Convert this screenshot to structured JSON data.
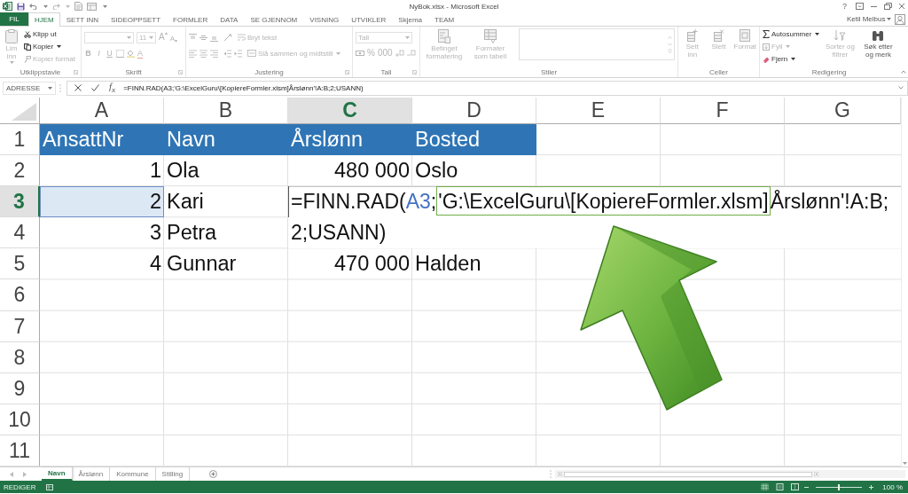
{
  "title_bar": {
    "title": "NyBok.xlsx - Microsoft Excel",
    "help": "?",
    "user": "Ketil Melbus"
  },
  "tabs": [
    {
      "label": "FIL",
      "kind": "backstage",
      "selected": false
    },
    {
      "label": "HJEM",
      "kind": "ribbon",
      "selected": true
    },
    {
      "label": "SETT INN",
      "kind": "ribbon",
      "selected": false
    },
    {
      "label": "SIDEOPPSETT",
      "kind": "ribbon",
      "selected": false
    },
    {
      "label": "FORMLER",
      "kind": "ribbon",
      "selected": false
    },
    {
      "label": "DATA",
      "kind": "ribbon",
      "selected": false
    },
    {
      "label": "SE GJENNOM",
      "kind": "ribbon",
      "selected": false
    },
    {
      "label": "VISNING",
      "kind": "ribbon",
      "selected": false
    },
    {
      "label": "UTVIKLER",
      "kind": "ribbon",
      "selected": false
    },
    {
      "label": "Skjema",
      "kind": "ribbon",
      "selected": false
    },
    {
      "label": "TEAM",
      "kind": "ribbon",
      "selected": false
    }
  ],
  "ribbon": {
    "clipboard": {
      "label": "Utklippstavle",
      "paste": {
        "label": "Lim inn",
        "disabled": true
      },
      "cut": {
        "label": "Klipp ut",
        "disabled": false
      },
      "copy": {
        "label": "Kopier",
        "disabled": false
      },
      "format_painter": {
        "label": "Kopier format",
        "disabled": true
      }
    },
    "font": {
      "label": "Skrift",
      "disabled": true,
      "size": "11",
      "grow": "A",
      "shrink": "A",
      "format_buttons": [
        {
          "label": "B",
          "kind": "bold"
        },
        {
          "label": "I",
          "kind": "italic"
        },
        {
          "label": "U",
          "kind": "underline"
        }
      ],
      "font_color": "A"
    },
    "alignment": {
      "label": "Justering",
      "disabled": true,
      "wrap_text": "Bryt tekst",
      "merge_center": "Slå sammen og midtstill"
    },
    "number": {
      "label": "Tall",
      "disabled": true,
      "format": "Tall",
      "percent": "%",
      "thousands": "000"
    },
    "styles": {
      "label": "Stiler",
      "disabled": true,
      "conditional_formatting": "Betinget formatering",
      "format_as_table": "Formater som tabell"
    },
    "cells": {
      "label": "Celler",
      "disabled": true,
      "insert": "Sett inn",
      "delete": "Slett",
      "format": "Format"
    },
    "editing": {
      "label": "Redigering",
      "autosum": {
        "label": "Autosummer",
        "disabled": false
      },
      "fill": {
        "label": "Fyll",
        "disabled": true
      },
      "clear": {
        "label": "Fjern",
        "disabled": false
      },
      "sort_filter": {
        "label": "Sorter og filtrer",
        "disabled": true
      },
      "find_select": {
        "label": "Søk etter og merk",
        "disabled": false
      }
    }
  },
  "formula_bar": {
    "name_box": "ADRESSE",
    "function_label": "f$_{x}$",
    "formula": "=FINN.RAD(A3;'G:\\ExcelGuru\\[KopiereFormler.xlsm]Årslønn'!A:B;2;USANN)"
  },
  "sheet": {
    "columns": [
      {
        "label": "A",
        "selected": false
      },
      {
        "label": "B",
        "selected": false
      },
      {
        "label": "C",
        "selected": true
      },
      {
        "label": "D",
        "selected": false
      },
      {
        "label": "E",
        "selected": false
      },
      {
        "label": "F",
        "selected": false
      },
      {
        "label": "G",
        "selected": false
      }
    ],
    "rows": [
      {
        "number": "1",
        "selected": false,
        "cells": [
          {
            "value": "AnsattNr",
            "kind": "heading",
            "referenced": false
          },
          {
            "value": "Navn",
            "kind": "heading",
            "referenced": false
          },
          {
            "value": "Årslønn",
            "kind": "heading",
            "referenced": false
          },
          {
            "value": "Bosted",
            "kind": "heading",
            "referenced": false
          }
        ]
      },
      {
        "number": "2",
        "selected": false,
        "cells": [
          {
            "value": "1",
            "kind": "number",
            "referenced": false
          },
          {
            "value": "Ola",
            "kind": "text",
            "referenced": false
          },
          {
            "value": "480 000",
            "kind": "number",
            "referenced": false
          },
          {
            "value": "Oslo",
            "kind": "text",
            "referenced": false
          }
        ]
      },
      {
        "number": "3",
        "selected": true,
        "cells": [
          {
            "value": "2",
            "kind": "number",
            "referenced": true
          },
          {
            "value": "Kari",
            "kind": "text",
            "referenced": false
          }
        ]
      },
      {
        "number": "4",
        "selected": false,
        "cells": [
          {
            "value": "3",
            "kind": "number",
            "referenced": false
          },
          {
            "value": "Petra",
            "kind": "text",
            "referenced": false
          }
        ]
      },
      {
        "number": "5",
        "selected": false,
        "cells": [
          {
            "value": "4",
            "kind": "number",
            "referenced": false
          },
          {
            "value": "Gunnar",
            "kind": "text",
            "referenced": false
          },
          {
            "value": "470 000",
            "kind": "number",
            "referenced": false
          },
          {
            "value": "Halden",
            "kind": "text",
            "referenced": false
          }
        ]
      },
      {
        "number": "6",
        "selected": false
      },
      {
        "number": "7",
        "selected": false
      },
      {
        "number": "8",
        "selected": false
      },
      {
        "number": "9",
        "selected": false
      },
      {
        "number": "10",
        "selected": false
      },
      {
        "number": "11",
        "selected": false
      }
    ],
    "cell_editor": {
      "lines": [
        [
          {
            "text": "=FINN.RAD(",
            "kind": "plain"
          },
          {
            "text": "A3",
            "kind": "reference"
          },
          {
            "text": ";",
            "kind": "plain"
          },
          {
            "text": "'G:\\ExcelGuru\\[KopiereFormler.xlsm]",
            "kind": "framed"
          },
          {
            "text": "Årslønn'!A:B;",
            "kind": "plain"
          }
        ],
        [
          {
            "text": "2;USANN)",
            "kind": "plain"
          }
        ]
      ]
    }
  },
  "sheet_tabs": [
    {
      "label": "Navn",
      "selected": true
    },
    {
      "label": "Årslønn",
      "selected": false
    },
    {
      "label": "Kommune",
      "selected": false
    },
    {
      "label": "Stilling",
      "selected": false
    }
  ],
  "status_bar": {
    "mode": "REDIGER",
    "zoom": "100 %",
    "zoom_slider": {
      "level": 0.5
    }
  }
}
